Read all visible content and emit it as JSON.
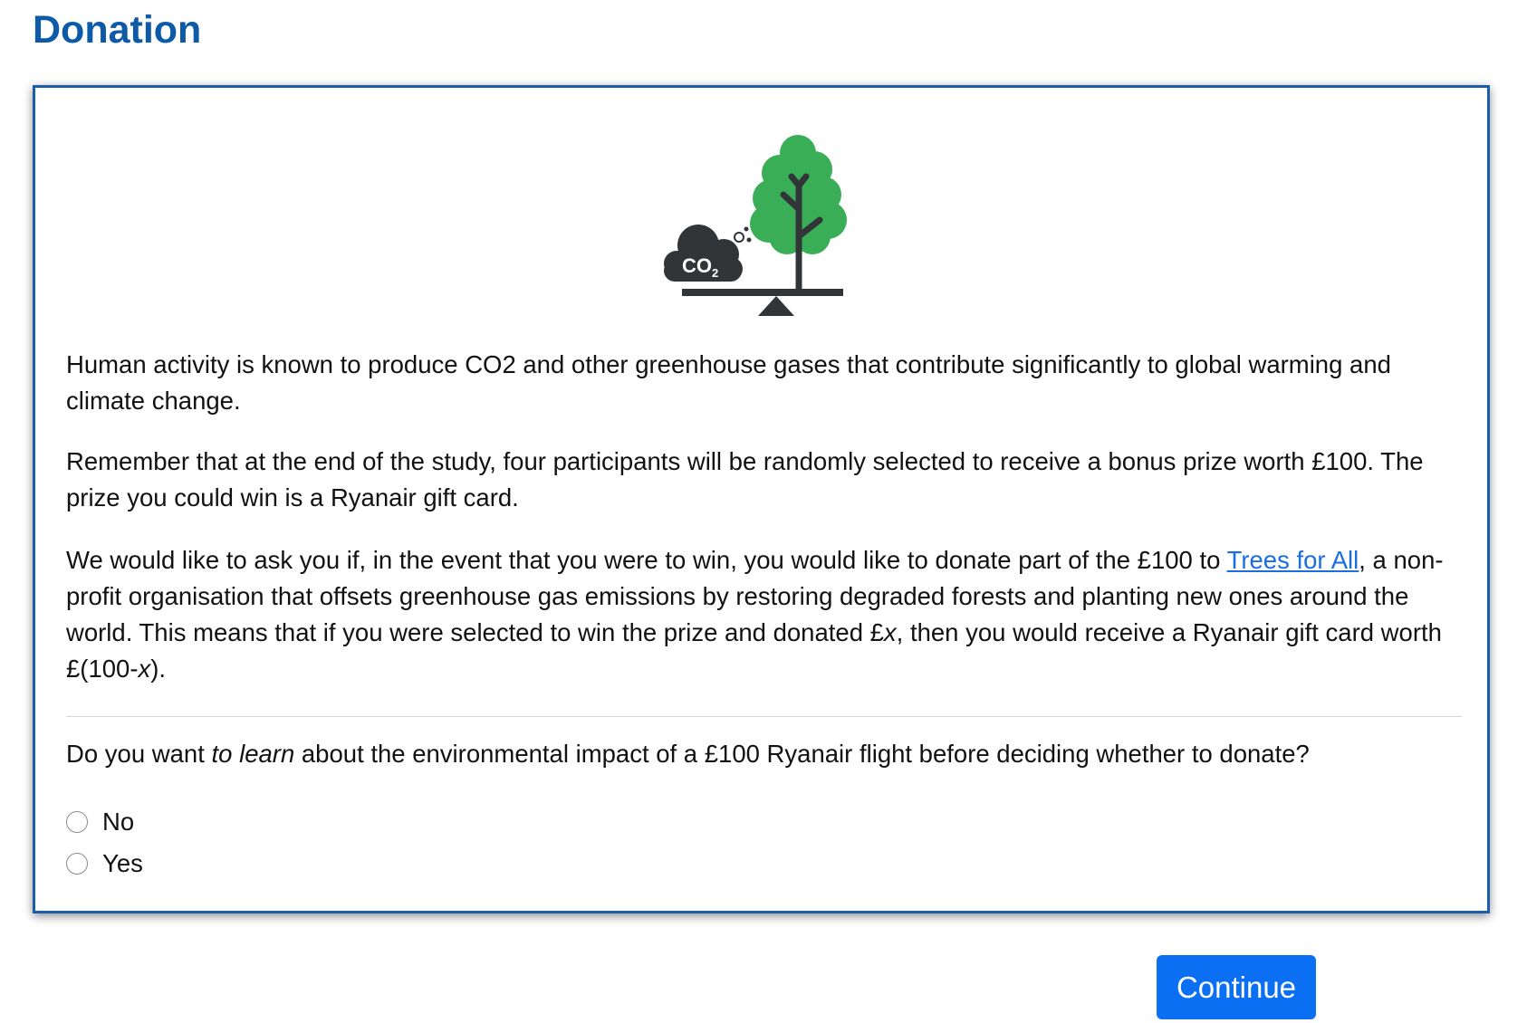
{
  "header": {
    "title": "Donation"
  },
  "illustration": {
    "co2_label": "CO",
    "co2_subscript": "2",
    "colors": {
      "tree": "#3aae57",
      "dark": "#323538"
    }
  },
  "content": {
    "paragraph1": "Human activity is known to produce CO2 and other greenhouse gases that contribute significantly to global warming and climate change.",
    "paragraph2": "Remember that at the end of the study, four participants will be randomly selected to receive a bonus prize worth £100. The prize you could win is a Ryanair gift card.",
    "paragraph3": {
      "before_link": "We would like to ask you if, in the event that you were to win, you would like to donate part of the £100 to ",
      "link_text": "Trees for All",
      "after_link": ", a non-profit organisation that offsets greenhouse gas emissions by restoring degraded forests and planting new ones around the world. This means that if you were selected to win the prize and donated £",
      "var_x": "x",
      "after_x": ", then you would receive a Ryanair gift card worth £(100-",
      "var_x2": "x",
      "end": ")."
    },
    "question": {
      "before_emphasis": "Do you want ",
      "emphasis": "to learn",
      "after_emphasis": " about the environmental impact of a £100 Ryanair flight before deciding whether to donate?"
    },
    "options": [
      {
        "label": "No",
        "selected": false
      },
      {
        "label": "Yes",
        "selected": false
      }
    ]
  },
  "footer": {
    "continue_label": "Continue"
  },
  "colors": {
    "title": "#0d5aa7",
    "card_border": "#1a5ea8",
    "link": "#1a6fe0",
    "button": "#0b6ff3"
  }
}
